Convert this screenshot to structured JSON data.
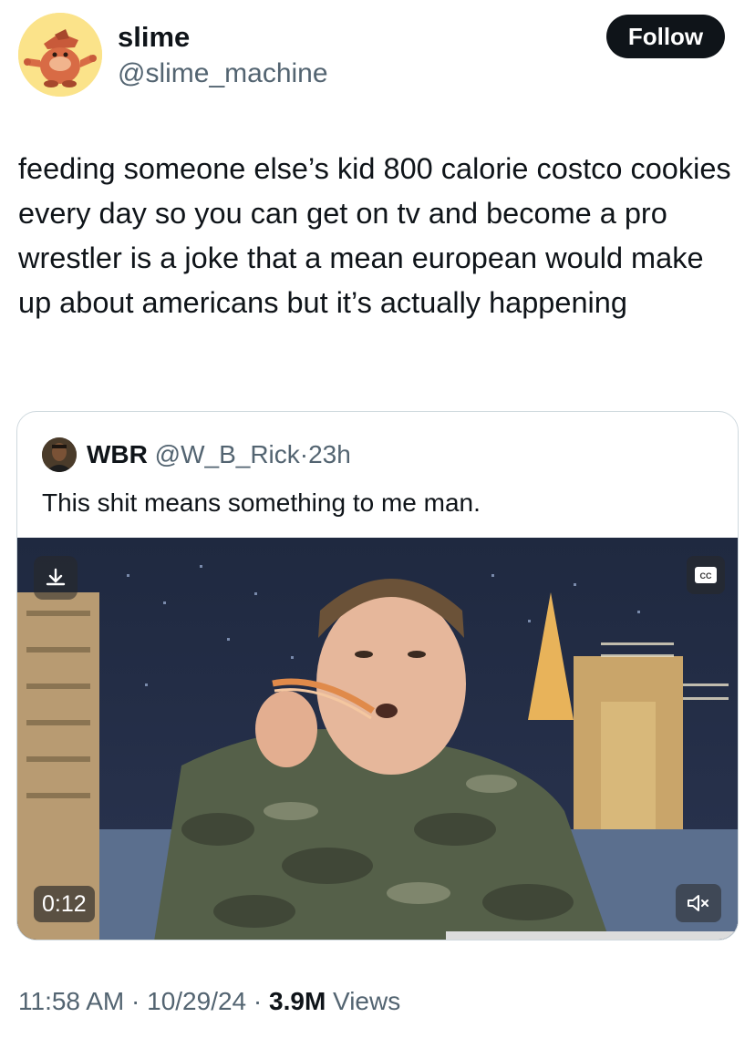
{
  "author": {
    "name": "slime",
    "handle": "@slime_machine",
    "avatar_icon": "cartoon-avatar-icon"
  },
  "follow_label": "Follow",
  "tweet_text": "feeding someone else’s kid 800 calorie costco cookies every day so you can get on tv and become a pro wrestler is a joke that a mean european would make up about americans but it’s actually happening",
  "quoted": {
    "name": "WBR",
    "handle": "@W_B_Rick",
    "separator": "·",
    "time": "23h",
    "text": "This shit means something to me man.",
    "video": {
      "duration": "0:12",
      "download_icon": "download-icon",
      "cc_icon": "closed-captions-icon",
      "mute_icon": "muted-speaker-icon"
    }
  },
  "footer": {
    "time": "11:58 AM",
    "sep1": " · ",
    "date": "10/29/24",
    "sep2": " · ",
    "views_count": "3.9M",
    "views_label": " Views"
  },
  "colors": {
    "text_primary": "#0f1419",
    "text_secondary": "#536471",
    "border": "#cfd9de",
    "follow_bg": "#0f1419",
    "avatar_bg": "#fbe38a"
  }
}
